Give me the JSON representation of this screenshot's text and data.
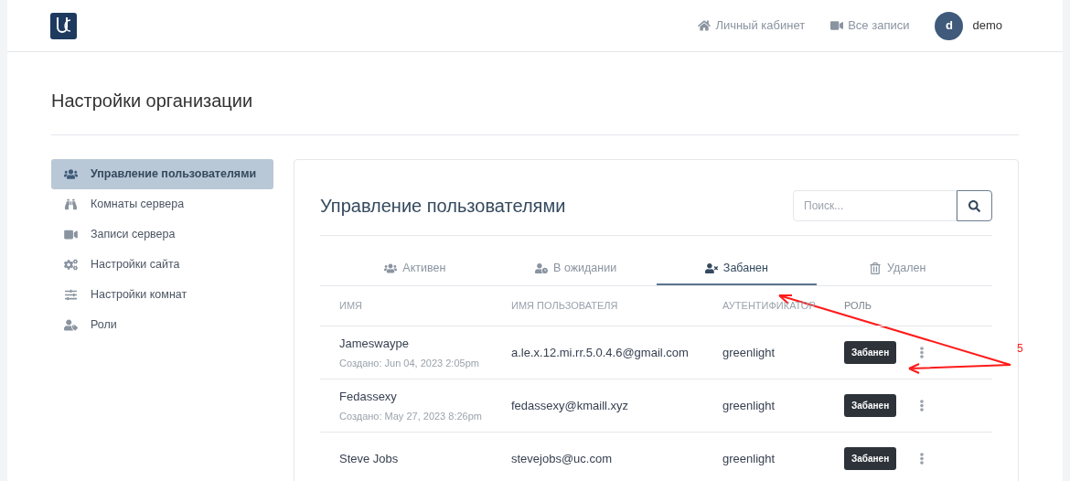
{
  "header": {
    "nav": [
      {
        "label": "Личный кабинет"
      },
      {
        "label": "Все записи"
      }
    ],
    "user": {
      "initial": "d",
      "name": "demo"
    }
  },
  "page_title": "Настройки организации",
  "sidebar": {
    "items": [
      {
        "label": "Управление пользователями",
        "selected": true
      },
      {
        "label": "Комнаты сервера",
        "selected": false
      },
      {
        "label": "Записи сервера",
        "selected": false
      },
      {
        "label": "Настройки сайта",
        "selected": false
      },
      {
        "label": "Настройки комнат",
        "selected": false
      },
      {
        "label": "Роли",
        "selected": false
      }
    ]
  },
  "panel": {
    "title": "Управление пользователями",
    "search": {
      "placeholder": "Поиск..."
    },
    "tabs": [
      {
        "label": "Активен",
        "selected": false
      },
      {
        "label": "В ожидании",
        "selected": false
      },
      {
        "label": "Забанен",
        "selected": true
      },
      {
        "label": "Удален",
        "selected": false
      }
    ],
    "table": {
      "columns": [
        "ИМЯ",
        "ИМЯ ПОЛЬЗОВАТЕЛЯ",
        "АУТЕНТИФИКАТОР",
        "РОЛЬ"
      ],
      "rows": [
        {
          "name": "Jameswaype",
          "created": "Создано: Jun 04, 2023 2:05pm",
          "username": "a.le.x.12.mi.rr.5.0.4.6@gmail.com",
          "authenticator": "greenlight",
          "role": "Забанен"
        },
        {
          "name": "Fedassexy",
          "created": "Создано: May 27, 2023 8:26pm",
          "username": "fedassexy@kmaill.xyz",
          "authenticator": "greenlight",
          "role": "Забанен"
        },
        {
          "name": "Steve Jobs",
          "username": "stevejobs@uc.com",
          "authenticator": "greenlight",
          "role": "Забанен"
        }
      ]
    }
  },
  "annotation": {
    "label": "5"
  }
}
